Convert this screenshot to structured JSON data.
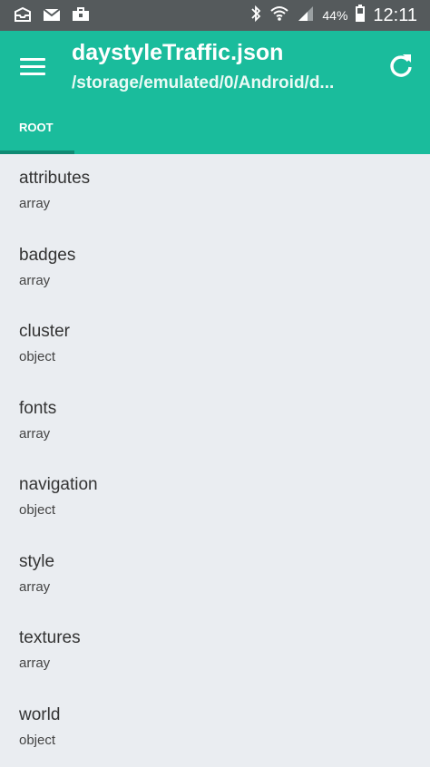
{
  "status_bar": {
    "battery": "44%",
    "time": "12:11",
    "left_icons": [
      "cloud-inbox-icon",
      "mail-icon",
      "briefcase-icon"
    ],
    "right_icons": [
      "bluetooth-icon",
      "wifi-icon",
      "signal-icon",
      "battery-icon"
    ]
  },
  "app_bar": {
    "title": "daystyleTraffic.json",
    "subtitle": "/storage/emulated/0/Android/d...",
    "color": "#1abc9c"
  },
  "tabs": [
    {
      "label": "ROOT",
      "selected": true
    }
  ],
  "items": [
    {
      "name": "attributes",
      "type": "array"
    },
    {
      "name": "badges",
      "type": "array"
    },
    {
      "name": "cluster",
      "type": "object"
    },
    {
      "name": "fonts",
      "type": "array"
    },
    {
      "name": "navigation",
      "type": "object"
    },
    {
      "name": "style",
      "type": "array"
    },
    {
      "name": "textures",
      "type": "array"
    },
    {
      "name": "world",
      "type": "object"
    }
  ]
}
